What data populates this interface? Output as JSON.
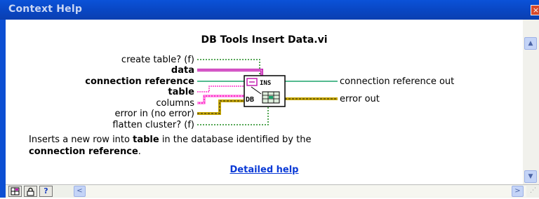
{
  "window": {
    "title": "Context Help",
    "close_glyph": "×"
  },
  "vi_title": "DB Tools Insert Data.vi",
  "inputs": [
    {
      "label": "create table? (f)",
      "bold": false
    },
    {
      "label": "data",
      "bold": true
    },
    {
      "label": "connection reference",
      "bold": true
    },
    {
      "label": "table",
      "bold": true
    },
    {
      "label": "columns",
      "bold": false
    },
    {
      "label": "error in (no error)",
      "bold": false
    },
    {
      "label": "flatten cluster? (f)",
      "bold": false
    }
  ],
  "outputs": [
    {
      "label": "connection reference out"
    },
    {
      "label": "error out"
    }
  ],
  "icon": {
    "top_text": "INS",
    "side_text": "DB"
  },
  "description": {
    "part1": "Inserts a new row into ",
    "bold1": "table",
    "part2": " in the database identified by the",
    "bold2": "connection reference",
    "part3": "."
  },
  "detailed_help_link": "Detailed help",
  "toolbar": {
    "help_glyph": "?",
    "scroll_left_glyph": "<",
    "scroll_right_glyph": ">"
  },
  "colors": {
    "titlebar": "#0b4fd2",
    "link": "#0a3ad6",
    "data_wire": "#c21fb0",
    "string_wire": "#ff33cc",
    "error_wire": "#c8a800",
    "refnum_wire": "#1ba36b",
    "boolean_wire": "#1f8a1f"
  }
}
